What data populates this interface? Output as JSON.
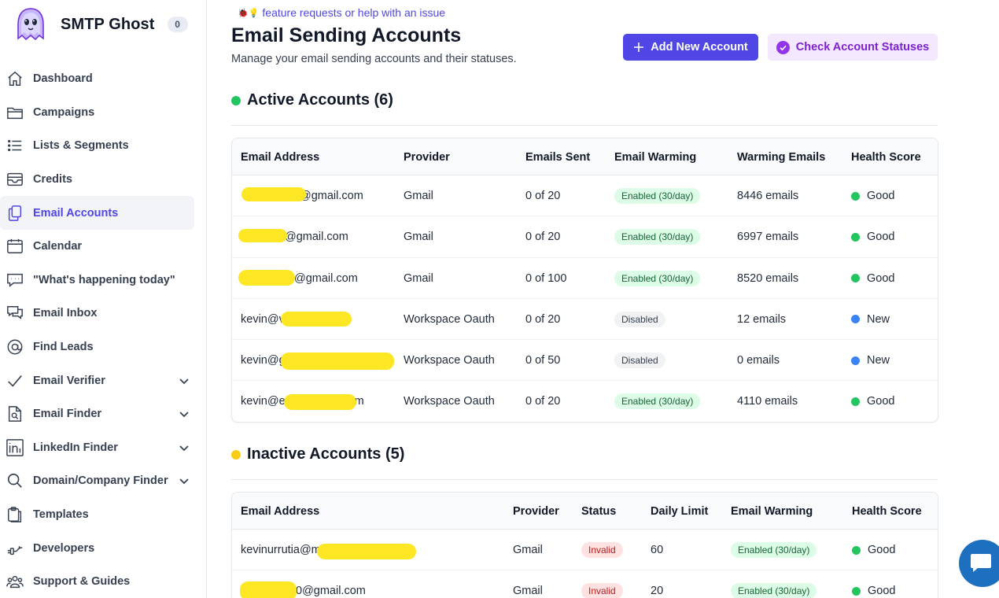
{
  "brand": {
    "name": "SMTP Ghost",
    "badge": "0"
  },
  "sidebar": {
    "items": [
      {
        "label": "Dashboard",
        "icon": "home-icon"
      },
      {
        "label": "Campaigns",
        "icon": "folder-icon"
      },
      {
        "label": "Lists & Segments",
        "icon": "list-icon"
      },
      {
        "label": "Credits",
        "icon": "inbox-icon"
      },
      {
        "label": "Email Accounts",
        "icon": "documents-icon",
        "active": true
      },
      {
        "label": "Calendar",
        "icon": "calendar-icon"
      },
      {
        "label": "\"What's happening today\"",
        "icon": "chat-icon"
      },
      {
        "label": "Email Inbox",
        "icon": "chat-bubbles-icon"
      },
      {
        "label": "Find Leads",
        "icon": "at-sign-icon"
      },
      {
        "label": "Email Verifier",
        "icon": "check-icon",
        "expandable": true
      },
      {
        "label": "Email Finder",
        "icon": "document-search-icon",
        "expandable": true
      },
      {
        "label": "LinkedIn Finder",
        "icon": "linkedin-icon",
        "expandable": true
      },
      {
        "label": "Domain/Company Finder",
        "icon": "search-icon",
        "expandable": true
      },
      {
        "label": "Templates",
        "icon": "clipboard-icon"
      },
      {
        "label": "Developers",
        "icon": "api-icon"
      },
      {
        "label": "Support & Guides",
        "icon": "users-icon"
      }
    ]
  },
  "header": {
    "help_link": "feature requests or help with an issue",
    "help_emoji": "🐞💡",
    "title": "Email Sending Accounts",
    "subtitle": "Manage your email sending accounts and their statuses.",
    "add_button": "Add New Account",
    "check_button": "Check Account Statuses"
  },
  "active": {
    "title": "Active Accounts (6)",
    "columns": [
      "Email Address",
      "Provider",
      "Emails Sent",
      "Email Warming",
      "Warming Emails",
      "Health Score"
    ],
    "rows": [
      {
        "email": "@gmail.com",
        "provider": "Gmail",
        "sent": "0 of 20",
        "warming": "Enabled (30/day)",
        "warming_on": true,
        "warm_emails": "8446 emails",
        "health": "Good"
      },
      {
        "email": "@gmail.com",
        "provider": "Gmail",
        "sent": "0 of 20",
        "warming": "Enabled (30/day)",
        "warming_on": true,
        "warm_emails": "6997 emails",
        "health": "Good"
      },
      {
        "email": "@gmail.com",
        "provider": "Gmail",
        "sent": "0 of 100",
        "warming": "Enabled (30/day)",
        "warming_on": true,
        "warm_emails": "8520 emails",
        "health": "Good"
      },
      {
        "email": "kevin@v",
        "provider": "Workspace Oauth",
        "sent": "0 of 20",
        "warming": "Disabled",
        "warming_on": false,
        "warm_emails": "12 emails",
        "health": "New"
      },
      {
        "email": "kevin@g",
        "provider": "Workspace Oauth",
        "sent": "0 of 50",
        "warming": "Disabled",
        "warming_on": false,
        "warm_emails": "0 emails",
        "health": "New"
      },
      {
        "email": "kevin@e",
        "email_tail": "m",
        "provider": "Workspace Oauth",
        "sent": "0 of 20",
        "warming": "Enabled (30/day)",
        "warming_on": true,
        "warm_emails": "4110 emails",
        "health": "Good"
      }
    ]
  },
  "inactive": {
    "title": "Inactive Accounts (5)",
    "columns": [
      "Email Address",
      "Provider",
      "Status",
      "Daily Limit",
      "Email Warming",
      "Health Score"
    ],
    "rows": [
      {
        "email": "kevinurrutia@m",
        "provider": "Gmail",
        "status": "Invalid",
        "limit": "60",
        "warming": "Enabled (30/day)",
        "health": "Good"
      },
      {
        "email": "0@gmail.com",
        "provider": "Gmail",
        "status": "Invalid",
        "limit": "20",
        "warming": "Enabled (30/day)",
        "health": "Good"
      }
    ]
  },
  "colors": {
    "accent": "#4f46e5",
    "good": "#22c55e",
    "new": "#3b82f6",
    "active_dot": "#22c55e",
    "inactive_dot": "#facc15",
    "redaction": "#fde724"
  }
}
